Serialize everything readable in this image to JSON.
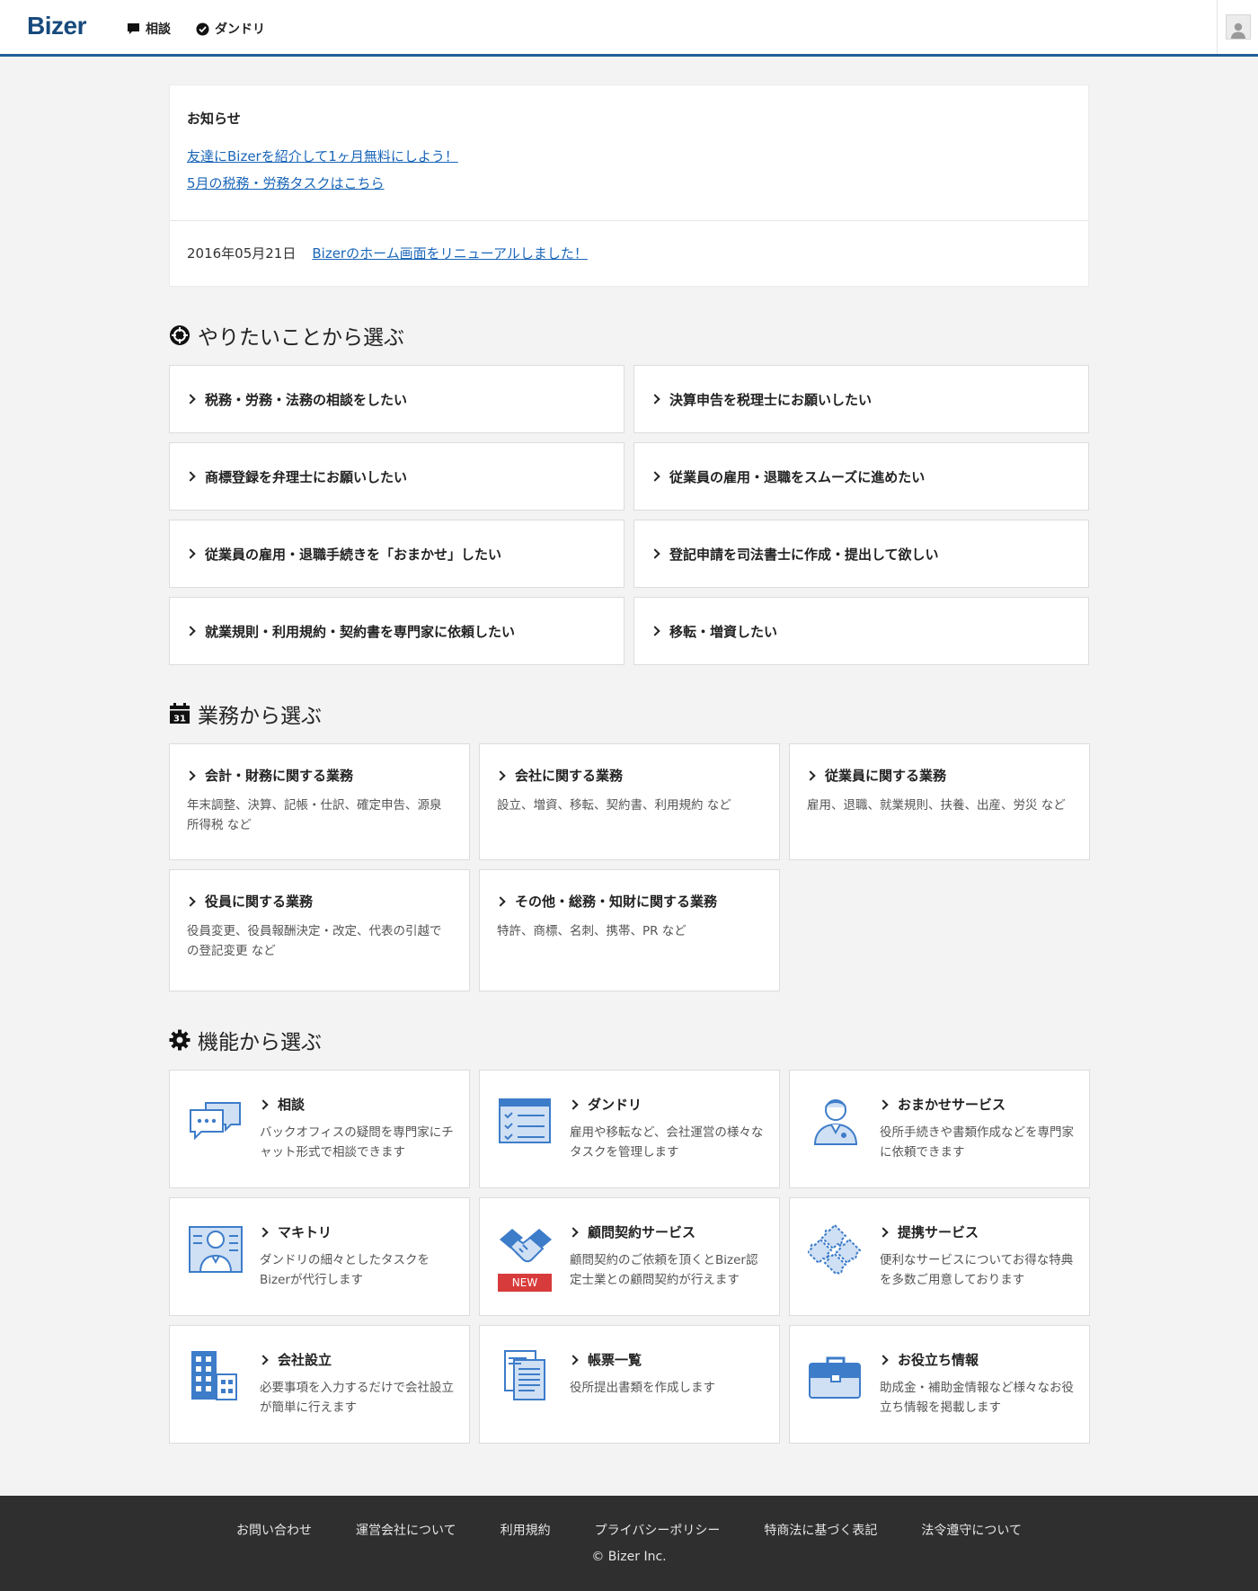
{
  "header": {
    "logo": "Bizer",
    "nav": [
      {
        "label": "相談",
        "icon": "chat-bubble-icon"
      },
      {
        "label": "ダンドリ",
        "icon": "check-circle-icon"
      }
    ],
    "avatar_icon": "user-avatar-icon"
  },
  "notice": {
    "title": "お知らせ",
    "links": [
      "友達にBizerを紹介して1ヶ月無料にしよう！",
      "5月の税務・労務タスクはこちら"
    ],
    "news_date": "2016年05月21日",
    "news_text": "Bizerのホーム画面をリニューアルしました！"
  },
  "want_section": {
    "title": "やりたいことから選ぶ",
    "icon": "target-icon",
    "items": [
      "税務・労務・法務の相談をしたい",
      "決算申告を税理士にお願いしたい",
      "商標登録を弁理士にお願いしたい",
      "従業員の雇用・退職をスムーズに進めたい",
      "従業員の雇用・退職手続きを「おまかせ」したい",
      "登記申請を司法書士に作成・提出して欲しい",
      "就業規則・利用規約・契約書を専門家に依頼したい",
      "移転・増資したい"
    ]
  },
  "work_section": {
    "title": "業務から選ぶ",
    "icon": "calendar-icon",
    "calendar_day": "31",
    "items": [
      {
        "title": "会計・財務に関する業務",
        "desc": "年末調整、決算、記帳・仕訳、確定申告、源泉所得税 など"
      },
      {
        "title": "会社に関する業務",
        "desc": "設立、増資、移転、契約書、利用規約 など"
      },
      {
        "title": "従業員に関する業務",
        "desc": "雇用、退職、就業規則、扶養、出産、労災 など"
      },
      {
        "title": "役員に関する業務",
        "desc": "役員変更、役員報酬決定・改定、代表の引越での登記変更 など"
      },
      {
        "title": "その他・総務・知財に関する業務",
        "desc": "特許、商標、名刺、携帯、PR など"
      }
    ]
  },
  "feature_section": {
    "title": "機能から選ぶ",
    "icon": "gear-icon",
    "new_badge": "NEW",
    "items": [
      {
        "title": "相談",
        "desc": "バックオフィスの疑問を専門家にチャット形式で相談できます",
        "icon": "chat-bubbles-icon"
      },
      {
        "title": "ダンドリ",
        "desc": "雇用や移転など、会社運営の様々なタスクを管理します",
        "icon": "checklist-icon"
      },
      {
        "title": "おまかせサービス",
        "desc": "役所手続きや書類作成などを専門家に依頼できます",
        "icon": "professional-person-icon"
      },
      {
        "title": "マキトリ",
        "desc": "ダンドリの細々としたタスクをBizerが代行します",
        "icon": "assistant-person-icon"
      },
      {
        "title": "顧問契約サービス",
        "desc": "顧問契約のご依頼を頂くとBizer認定士業との顧問契約が行えます",
        "icon": "handshake-icon"
      },
      {
        "title": "提携サービス",
        "desc": "便利なサービスについてお得な特典を多数ご用意しております",
        "icon": "puzzle-icon"
      },
      {
        "title": "会社設立",
        "desc": "必要事項を入力するだけで会社設立が簡単に行えます",
        "icon": "building-icon"
      },
      {
        "title": "帳票一覧",
        "desc": "役所提出書類を作成します",
        "icon": "documents-icon"
      },
      {
        "title": "お役立ち情報",
        "desc": "助成金・補助金情報など様々なお役立ち情報を掲載します",
        "icon": "briefcase-icon"
      }
    ]
  },
  "footer": {
    "links": [
      "お問い合わせ",
      "運営会社について",
      "利用規約",
      "プライバシーポリシー",
      "特商法に基づく表記",
      "法令遵守について"
    ],
    "copyright": "© Bizer Inc."
  },
  "colors": {
    "brand": "#174a7c",
    "accent_border": "#1f5f98",
    "link": "#1a66b8",
    "icon_blue": "#3d7cc9",
    "new_badge": "#d83b3b",
    "footer_bg": "#2f2f2f"
  }
}
